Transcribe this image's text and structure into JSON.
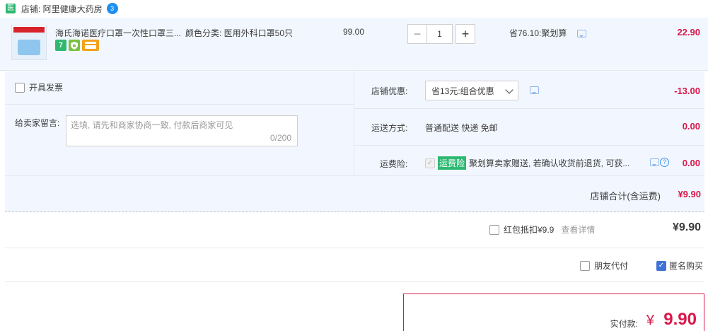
{
  "shop": {
    "type_badge": "医",
    "label": "店铺: 阿里健康大药房",
    "badge": "3"
  },
  "item": {
    "title": "海氏海诺医疗口罩一次性口罩三...",
    "spec": "颜色分类: 医用外科口罩50只",
    "unit_price": "99.00",
    "quantity": "1",
    "minus": "−",
    "plus": "+",
    "promo_note": "省76.10:聚划算",
    "total": "22.90",
    "service_icons": [
      "7",
      "shield-icon",
      "card-icon"
    ]
  },
  "options": {
    "invoice_label": "开具发票",
    "message_label": "给卖家留言:",
    "message_placeholder": "选填, 请先和商家协商一致, 付款后商家可见",
    "message_count": "0/200",
    "coupon_label": "店铺优惠:",
    "coupon_selected": "省13元:组合优惠",
    "coupon_amount": "-13.00",
    "shipping_label": "运送方式:",
    "shipping_value": "普通配送 快递 免邮",
    "shipping_amount": "0.00",
    "insurance_label": "运费险:",
    "insurance_tag": "运费险",
    "insurance_text": "聚划算卖家赠送, 若确认收货前退货, 可获...",
    "insurance_amount": "0.00"
  },
  "shop_total": {
    "label": "店铺合计(含运费)",
    "value": "¥9.90"
  },
  "redpack": {
    "label": "红包抵扣¥9.9",
    "link": "查看详情",
    "amount": "¥9.90"
  },
  "checkout_options": {
    "friend_pay": "朋友代付",
    "anonymous": "匿名购买"
  },
  "payment": {
    "label": "实付款:",
    "currency": "¥",
    "value": "9.90"
  },
  "colors": {
    "accent_red": "#d9184a",
    "tag_green": "#2eb872",
    "panel_bg": "#f2f7ff",
    "check_blue": "#3f72d6"
  }
}
